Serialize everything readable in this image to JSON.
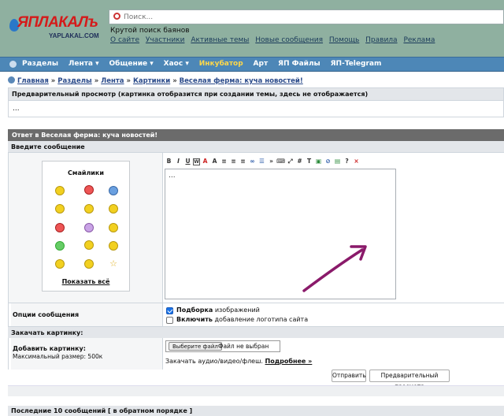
{
  "logo": {
    "main": "ЯПЛАКАЛъ",
    "sub": "YAPLAKAL.COM"
  },
  "search": {
    "placeholder": "Поиск..."
  },
  "tagline": "Крутой поиск баянов",
  "top_links": [
    "О сайте",
    "Участники",
    "Активные темы",
    "Новые сообщения",
    "Помощь",
    "Правила",
    "Реклама"
  ],
  "nav": [
    "Разделы",
    "Лента ▾",
    "Общение ▾",
    "Хаос ▾",
    "Инкубатор",
    "Арт",
    "ЯП Файлы",
    "ЯП-Telegram"
  ],
  "breadcrumb": [
    "Главная",
    "Разделы",
    "Лента",
    "Картинки",
    "Веселая ферма: куча новостей!"
  ],
  "preview": {
    "header": "Предварительный просмотр (картинка отобразится при создании темы, здесь не отображается)",
    "body": "..."
  },
  "reply": {
    "title": "Ответ в Веселая ферма: куча новостей!",
    "enter_message": "Введите сообщение"
  },
  "smileys": {
    "title": "Смайлики",
    "show_all": "Показать всё"
  },
  "toolbar": [
    "B",
    "I",
    "U",
    "W",
    "A",
    "A",
    "≡",
    "≡",
    "≡",
    "∞",
    "☰",
    "»",
    "⌨",
    "⤢",
    "#",
    "T",
    "▣",
    "⊘",
    "▤",
    "?",
    "×"
  ],
  "editor": {
    "value": "..."
  },
  "options": {
    "label": "Опции сообщения",
    "opt1_bold": "Подборка",
    "opt1_rest": " изображений",
    "opt2_bold": "Включить",
    "opt2_rest": " добавление логотипа сайта"
  },
  "upload": {
    "header": "Закачать картинку:",
    "label": "Добавить картинку:",
    "max_size": "Максимальный размер: 500к",
    "choose_button": "Выберите файл",
    "no_file": "Файл не выбран",
    "audio_text": "Закачать аудио/видео/флеш.",
    "more_link": "Подробнее »"
  },
  "buttons": {
    "send": "Отправить",
    "preview": "Предварительный просмотр"
  },
  "last10": "Последние 10 сообщений [ в обратном порядке ]",
  "colors": {
    "nav_bg": "#4d87b7",
    "page_bg": "#8fb0a0",
    "arrow": "#8a1a6a",
    "title_bar": "#6b6b6b"
  }
}
